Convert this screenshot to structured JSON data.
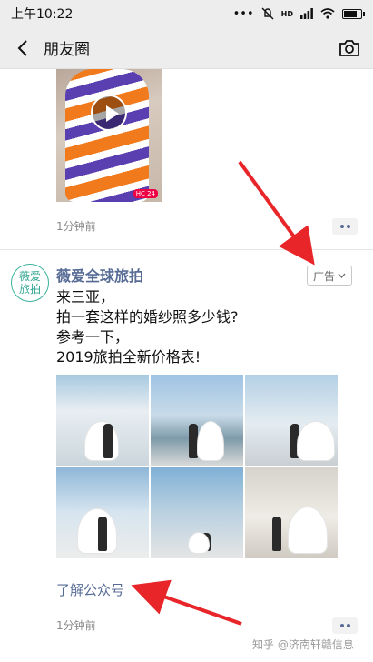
{
  "status_bar": {
    "time": "上午10:22",
    "signal_label": "HD"
  },
  "nav": {
    "title": "朋友圈"
  },
  "prev_post": {
    "time": "1分钟前",
    "video_tag": "HC 24"
  },
  "ad_post": {
    "avatar_text": "薇爱旅拍",
    "poster_name": "薇爱全球旅拍",
    "ad_label": "广告",
    "lines": [
      "来三亚，",
      "拍一套这样的婚纱照多少钱?",
      "参考一下，",
      "2019旅拍全新价格表!"
    ],
    "learn_more": "了解公众号",
    "time": "1分钟前"
  },
  "watermark": "知乎 @济南轩赣信息",
  "colors": {
    "link": "#576b95",
    "arrow": "#e8262a",
    "bar": "#ededed"
  }
}
